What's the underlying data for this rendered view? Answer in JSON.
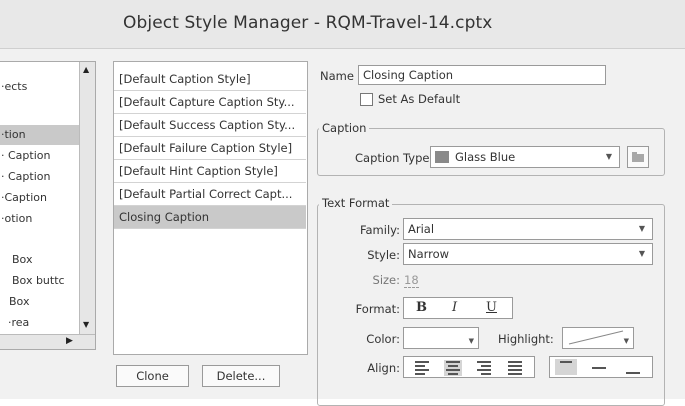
{
  "window": {
    "title": "Object Style Manager - RQM-Travel-14.cptx"
  },
  "tree": {
    "items": [
      "·ects",
      "·tion",
      "· Caption",
      "· Caption",
      "·Caption",
      "·otion",
      "Box",
      "Box buttc",
      "Box",
      "·rea"
    ]
  },
  "style_list": {
    "items": [
      "[Default Caption Style]",
      "[Default Capture Caption Sty...",
      "[Default Success Caption Sty...",
      "[Default Failure Caption Style]",
      "[Default Hint Caption Style]",
      "[Default Partial Correct Capt...",
      "Closing Caption"
    ],
    "selected": "Closing Caption"
  },
  "buttons": {
    "clone": "Clone",
    "delete": "Delete..."
  },
  "name_field": {
    "label": "Name",
    "value": "Closing Caption"
  },
  "set_default": {
    "label": "Set As Default",
    "checked": false
  },
  "caption_group": {
    "title": "Caption",
    "type_label": "Caption Type",
    "type_value": "Glass Blue"
  },
  "text_format": {
    "title": "Text Format",
    "family_label": "Family:",
    "family_value": "Arial",
    "style_label": "Style:",
    "style_value": "Narrow",
    "size_label": "Size:",
    "size_value": "18",
    "format_label": "Format:",
    "bold": "B",
    "italic": "I",
    "underline": "U",
    "color_label": "Color:",
    "highlight_label": "Highlight:",
    "align_label": "Align:"
  }
}
